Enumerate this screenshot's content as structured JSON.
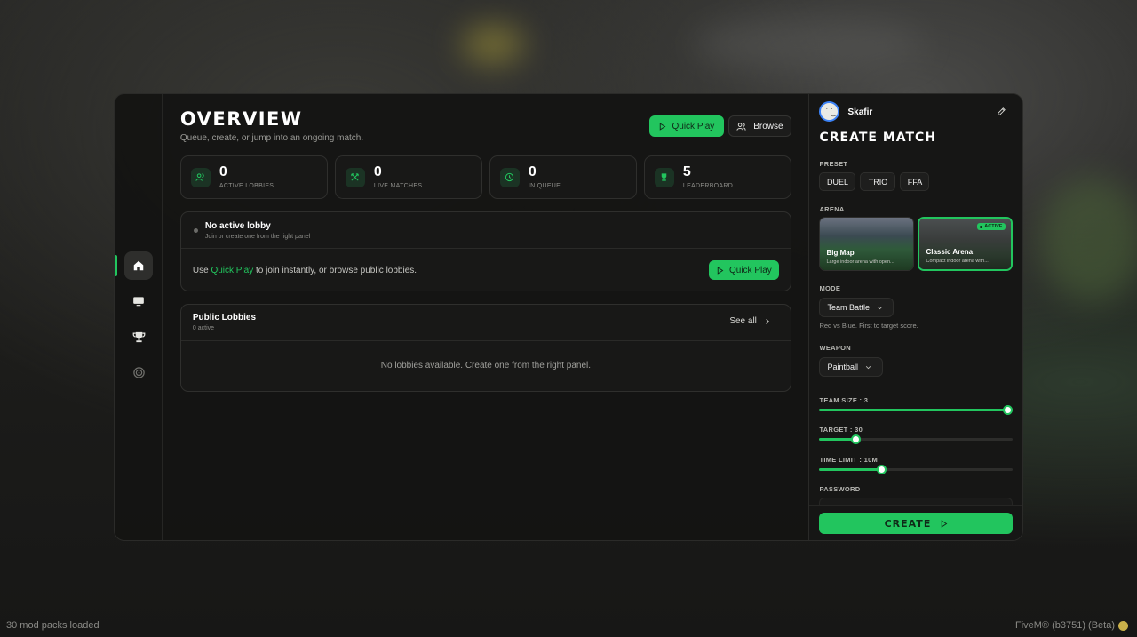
{
  "main": {
    "title": "OVERVIEW",
    "subtitle": "Queue, create, or jump into an ongoing match.",
    "quick_play_label": "Quick Play",
    "browse_label": "Browse",
    "stats": [
      {
        "value": "0",
        "label": "ACTIVE LOBBIES",
        "icon": "users-icon"
      },
      {
        "value": "0",
        "label": "LIVE MATCHES",
        "icon": "crossed-swords-icon"
      },
      {
        "value": "0",
        "label": "IN QUEUE",
        "icon": "clock-icon"
      },
      {
        "value": "5",
        "label": "LEADERBOARD",
        "icon": "trophy-icon"
      }
    ],
    "lobby": {
      "title": "No active lobby",
      "subtitle": "Join or create one from the right panel",
      "message_prefix": "Use ",
      "message_link": "Quick Play",
      "message_suffix": " to join instantly, or browse public lobbies.",
      "quick_play_label": "Quick Play"
    },
    "public_lobbies": {
      "title": "Public Lobbies",
      "count": "0 active",
      "see_all": "See all",
      "empty": "No lobbies available. Create one from the right panel."
    }
  },
  "sidebar": {
    "items": [
      {
        "name": "home",
        "icon": "home-icon",
        "active": true
      },
      {
        "name": "monitor",
        "icon": "monitor-icon",
        "active": false
      },
      {
        "name": "trophy",
        "icon": "trophy-icon",
        "active": false
      },
      {
        "name": "target",
        "icon": "target-icon",
        "active": false
      }
    ]
  },
  "panel": {
    "username": "Skafir",
    "title": "CREATE MATCH",
    "preset_label": "PRESET",
    "presets": [
      "DUEL",
      "TRIO",
      "FFA"
    ],
    "arena_label": "ARENA",
    "arenas": [
      {
        "name": "Big Map",
        "desc": "Large indoor arena with open...",
        "active": false
      },
      {
        "name": "Classic Arena",
        "desc": "Compact indoor arena with...",
        "active": true,
        "badge": "ACTIVE"
      }
    ],
    "mode_label": "MODE",
    "mode_value": "Team Battle",
    "mode_hint": "Red vs Blue. First to target score.",
    "weapon_label": "WEAPON",
    "weapon_value": "Paintball",
    "team_size_label": "TEAM SIZE : 3",
    "team_size_fraction": 1.0,
    "target_label": "TARGET : 30",
    "target_fraction": 0.19,
    "time_limit_label": "TIME LIMIT : 10M",
    "time_limit_fraction": 0.32,
    "password_label": "PASSWORD",
    "create_label": "CREATE"
  },
  "footer": {
    "left": "30 mod packs loaded",
    "right": "FiveM® (b3751) (Beta)"
  },
  "colors": {
    "accent": "#22c55e",
    "panel_bg": "#141413"
  }
}
